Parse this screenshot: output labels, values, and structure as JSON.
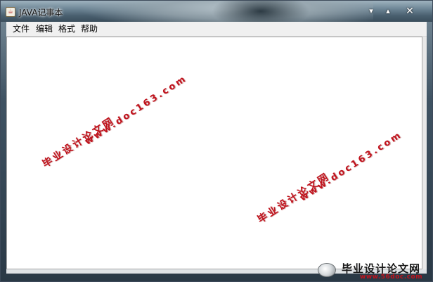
{
  "window": {
    "title": "JAVA记事本",
    "icon": "java-cup-icon",
    "controls": {
      "minimize": "▾",
      "maximize": "▴",
      "close": "✕"
    }
  },
  "menu": {
    "items": [
      "文件",
      "编辑",
      "格式",
      "帮助"
    ]
  },
  "editor": {
    "text": ""
  },
  "watermarks": [
    {
      "cn": "毕业设计论文网",
      "url": "www.doc163.com"
    },
    {
      "cn": "毕业设计论文网",
      "url": "www.doc163.com"
    }
  ],
  "site_logo": {
    "text": "毕业设计论文网",
    "url": "www.56doc.com"
  }
}
